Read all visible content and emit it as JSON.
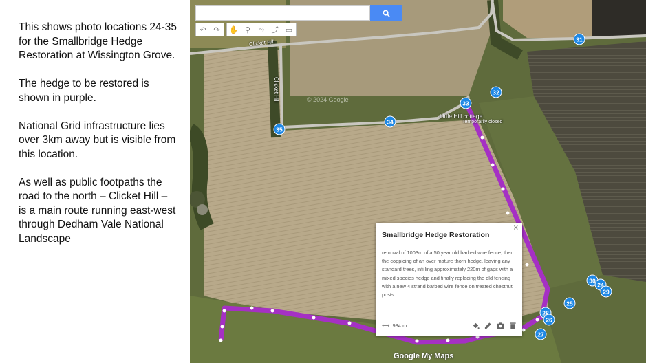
{
  "description_panel": {
    "paragraphs": [
      "This shows photo locations 24-35 for the Smallbridge Hedge Restoration at Wissington Grove.",
      "The hedge to be restored is shown in purple.",
      "National Grid infrastructure lies over 3km away but is visible from this location.",
      "As well as public footpaths  the road to the north – Clicket Hill – is a main route running east-west through Dedham Vale National Landscape"
    ]
  },
  "search": {
    "value": "",
    "placeholder": "",
    "icon": "search-icon"
  },
  "toolbar": {
    "icons": [
      "undo-icon",
      "redo-icon",
      "hand-icon",
      "marker-icon",
      "line-icon",
      "directions-icon",
      "ruler-icon"
    ]
  },
  "map": {
    "road_labels": {
      "clicket_top": "Clicket Hill",
      "clicket_side": "Clicket Hill"
    },
    "place_label": "Little Hill cottage",
    "place_sublabel": "Temporarily closed",
    "watermark": "© 2024 Google",
    "logo": "Google My Maps",
    "hedge_color": "#a530c4",
    "markers": [
      "31",
      "32",
      "33",
      "34",
      "35",
      "30",
      "24",
      "29",
      "25",
      "28",
      "26",
      "27"
    ]
  },
  "popup": {
    "title": "Smallbridge Hedge Restoration",
    "description": "removal of 1003m of a 50 year old barbed wire fence, then the coppicing of an over mature thorn hedge, leaving any standard trees, infilling approximately 220m of gaps with a mixed species hedge and finally replacing the old fencing with a new 4 strand barbed wire fence on treated chestnut posts.",
    "length": "984 m",
    "close": "×",
    "actions": [
      "paint-icon",
      "edit-icon",
      "camera-icon",
      "delete-icon"
    ]
  }
}
